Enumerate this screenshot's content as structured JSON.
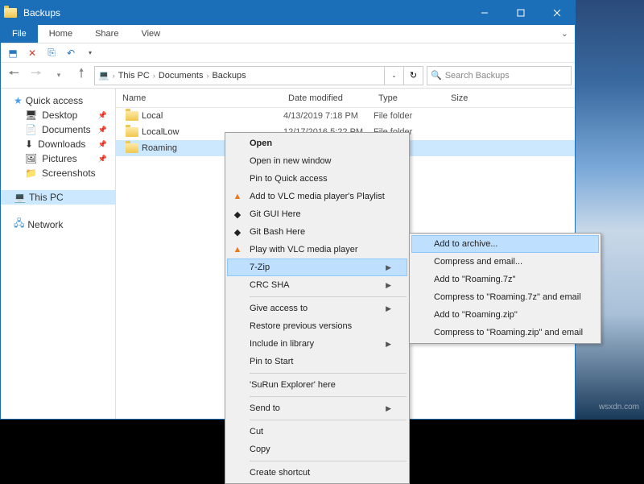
{
  "window": {
    "title": "Backups",
    "menubar": {
      "file": "File",
      "home": "Home",
      "share": "Share",
      "view": "View"
    }
  },
  "breadcrumb": {
    "root": "This PC",
    "p1": "Documents",
    "p2": "Backups"
  },
  "search": {
    "placeholder": "Search Backups"
  },
  "columns": {
    "name": "Name",
    "date": "Date modified",
    "type": "Type",
    "size": "Size"
  },
  "sidebar": {
    "quick": "Quick access",
    "items": [
      "Desktop",
      "Documents",
      "Downloads",
      "Pictures",
      "Screenshots"
    ],
    "thispc": "This PC",
    "network": "Network"
  },
  "files": [
    {
      "name": "Local",
      "date": "4/13/2019 7:18 PM",
      "type": "File folder"
    },
    {
      "name": "LocalLow",
      "date": "12/17/2016 5:22 PM",
      "type": "File folder"
    },
    {
      "name": "Roaming",
      "date": "",
      "type": ""
    }
  ],
  "context": {
    "open": "Open",
    "newwin": "Open in new window",
    "pinquick": "Pin to Quick access",
    "vlcplaylist": "Add to VLC media player's Playlist",
    "gitgui": "Git GUI Here",
    "gitbash": "Git Bash Here",
    "vlcplay": "Play with VLC media player",
    "sevenzip": "7-Zip",
    "crcsha": "CRC SHA",
    "giveaccess": "Give access to",
    "restore": "Restore previous versions",
    "include": "Include in library",
    "pinstart": "Pin to Start",
    "surun": "'SuRun Explorer' here",
    "sendto": "Send to",
    "cut": "Cut",
    "copy": "Copy",
    "shortcut": "Create shortcut"
  },
  "submenu": {
    "addarchive": "Add to archive...",
    "compemail": "Compress and email...",
    "add7z": "Add to \"Roaming.7z\"",
    "comp7zemail": "Compress to \"Roaming.7z\" and email",
    "addzip": "Add to \"Roaming.zip\"",
    "compzipemail": "Compress to \"Roaming.zip\" and email"
  },
  "watermark": "wsxdn.com"
}
